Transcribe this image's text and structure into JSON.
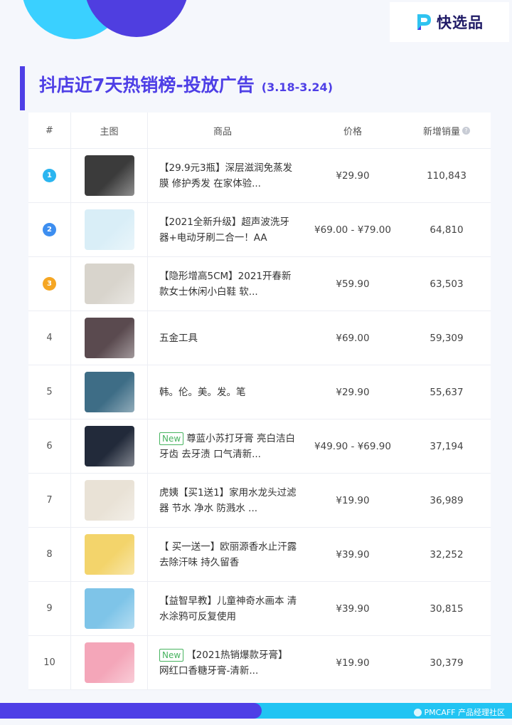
{
  "logo": {
    "text": "快选品",
    "color": "#1f1a66",
    "accent": "#3a2fd9"
  },
  "title": {
    "main": "抖店近7天热销榜-投放广告",
    "sub": "(3.18-3.24)",
    "color": "#4e3fe6"
  },
  "table": {
    "headers": {
      "rank": "#",
      "image": "主图",
      "goods": "商品",
      "price": "价格",
      "sales": "新增销量"
    },
    "rows": [
      {
        "rank": "1",
        "tag": "",
        "name": "【29.9元3瓶】深层滋润免蒸发膜 修护秀发 在家体验...",
        "price": "¥29.90",
        "sales": "110,843"
      },
      {
        "rank": "2",
        "tag": "",
        "name": "【2021全新升级】超声波洗牙器+电动牙刷二合一！AA",
        "price": "¥69.00 - ¥79.00",
        "sales": "64,810"
      },
      {
        "rank": "3",
        "tag": "",
        "name": "【隐形增高5CM】2021开春新款女士休闲小白鞋 软...",
        "price": "¥59.90",
        "sales": "63,503"
      },
      {
        "rank": "4",
        "tag": "",
        "name": "五金工具",
        "price": "¥69.00",
        "sales": "59,309"
      },
      {
        "rank": "5",
        "tag": "",
        "name": "韩。伦。美。发。笔",
        "price": "¥29.90",
        "sales": "55,637"
      },
      {
        "rank": "6",
        "tag": "New",
        "name": "尊蓝小苏打牙膏 亮白洁白牙齿 去牙渍 口气清新...",
        "price": "¥49.90 - ¥69.90",
        "sales": "37,194"
      },
      {
        "rank": "7",
        "tag": "",
        "name": "虎姨【买1送1】家用水龙头过滤器 节水 净水 防溅水 ...",
        "price": "¥19.90",
        "sales": "36,989"
      },
      {
        "rank": "8",
        "tag": "",
        "name": "【 买一送一】欧丽源香水止汗露 去除汗味 持久留香",
        "price": "¥39.90",
        "sales": "32,252"
      },
      {
        "rank": "9",
        "tag": "",
        "name": "【益智早教】儿童神奇水画本 清水涂鸦可反复使用",
        "price": "¥39.90",
        "sales": "30,815"
      },
      {
        "rank": "10",
        "tag": "New",
        "name": "【2021热销爆款牙膏】网红口香糖牙膏-清新...",
        "price": "¥19.90",
        "sales": "30,379"
      }
    ],
    "badge_colors": [
      "#2bb5f0",
      "#3d8ef0",
      "#f5a623"
    ],
    "thumb_colors": [
      "#3b3b3b",
      "#d9eef7",
      "#d8d4cc",
      "#5a4a4f",
      "#3e6d86",
      "#222a3a",
      "#e9e2d6",
      "#f3d46b",
      "#7ec4e8",
      "#f4a6b9"
    ]
  },
  "footer": {
    "watermark": "PMCAFF 产品经理社区"
  }
}
